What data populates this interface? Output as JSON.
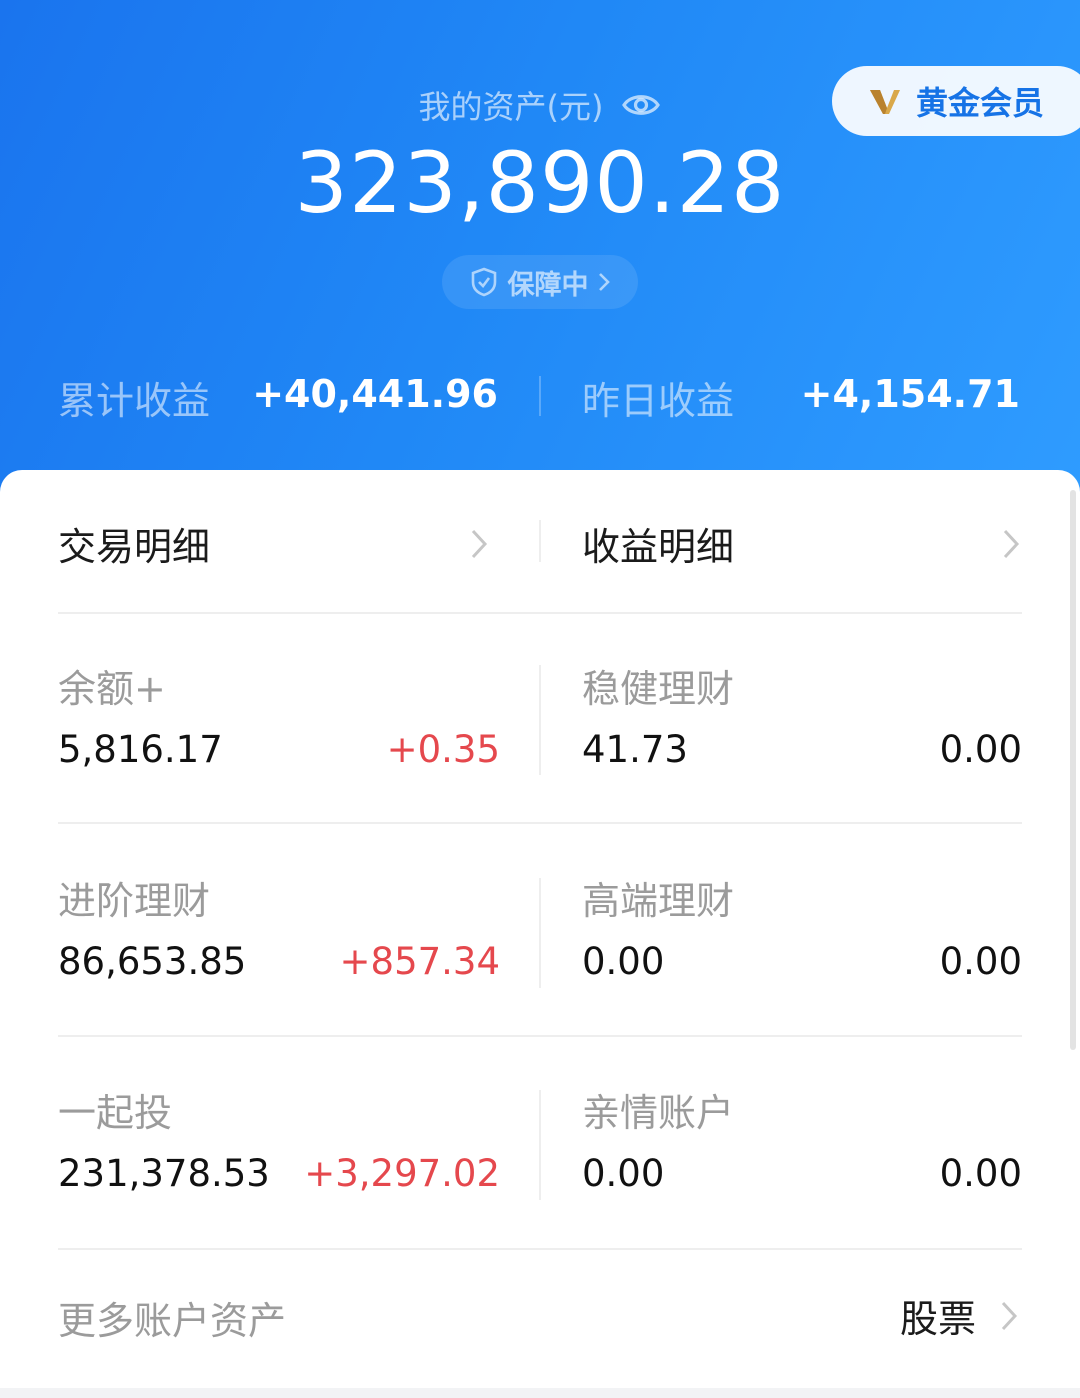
{
  "header": {
    "asset_label": "我的资产(元)",
    "asset_value": "323,890.28",
    "protect_label": "保障中",
    "vip_label": "黄金会员",
    "cumulative_label": "累计收益",
    "cumulative_value": "+40,441.96",
    "yesterday_label": "昨日收益",
    "yesterday_value": "+4,154.71"
  },
  "nav": {
    "transactions_label": "交易明细",
    "earnings_label": "收益明细"
  },
  "accounts": [
    {
      "label": "余额+",
      "amount": "5,816.17",
      "change": "+0.35",
      "change_color": "#e5484d"
    },
    {
      "label": "稳健理财",
      "amount": "41.73",
      "change": "0.00",
      "change_color": "#111111"
    },
    {
      "label": "进阶理财",
      "amount": "86,653.85",
      "change": "+857.34",
      "change_color": "#e5484d"
    },
    {
      "label": "高端理财",
      "amount": "0.00",
      "change": "0.00",
      "change_color": "#111111"
    },
    {
      "label": "一起投",
      "amount": "231,378.53",
      "change": "+3,297.02",
      "change_color": "#e5484d"
    },
    {
      "label": "亲情账户",
      "amount": "0.00",
      "change": "0.00",
      "change_color": "#111111"
    }
  ],
  "more": {
    "label": "更多账户资产",
    "link_label": "股票"
  },
  "colors": {
    "header_blue": "#1a74ee",
    "positive_red": "#e5484d"
  }
}
